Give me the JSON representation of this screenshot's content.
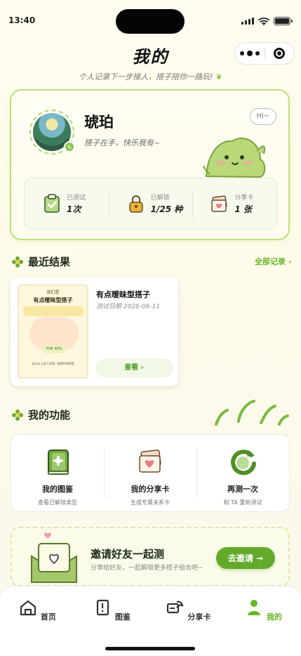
{
  "status_bar": {
    "time": "13:40"
  },
  "header": {
    "title": "我的",
    "subtitle": "个人记录下一步接人，搭子陪你一路玩!"
  },
  "profile": {
    "name": "琥珀",
    "bio": "搭子在手，快乐我有~",
    "hi_bubble": "Hi~",
    "stats": [
      {
        "label": "已测试",
        "value": "1次",
        "icon": "clipboard-check-icon"
      },
      {
        "label": "已解锁",
        "value": "1/25 种",
        "icon": "lock-icon"
      },
      {
        "label": "分享卡",
        "value": "1 张",
        "icon": "share-card-icon"
      }
    ]
  },
  "recent": {
    "title": "最近结果",
    "all_link": "全部记录 ›",
    "result": {
      "name": "有点暧昧型搭子",
      "date": "测试日期 2026-06-11",
      "view_label": "查看 ›",
      "poster_top": "我们是",
      "poster_title": "有点暧昧型搭子",
      "poster_badge": "TOP 30%",
      "poster_note": "友达以上恋人未满，刚刚好的默契"
    }
  },
  "features": {
    "title": "我的功能",
    "items": [
      {
        "label": "我的图鉴",
        "desc": "查看已解锁类型",
        "icon": "book-icon"
      },
      {
        "label": "我的分享卡",
        "desc": "生成专属关系卡",
        "icon": "share-card-icon"
      },
      {
        "label": "再测一次",
        "desc": "和 TA 重新测试",
        "icon": "refresh-icon"
      }
    ]
  },
  "invite": {
    "title": "邀请好友一起测",
    "desc": "分享给好友，一起解锁更多搭子组合吧~",
    "button": "去邀请 →"
  },
  "tabs": [
    {
      "label": "首页",
      "icon": "home-icon",
      "active": false
    },
    {
      "label": "图鉴",
      "icon": "book-alert-icon",
      "active": false
    },
    {
      "label": "分享卡",
      "icon": "share-icon",
      "active": false
    },
    {
      "label": "我的",
      "icon": "user-icon",
      "active": true
    }
  ],
  "colors": {
    "accent": "#67b623",
    "card_border": "#b9e27b",
    "background": "#fffbea"
  }
}
